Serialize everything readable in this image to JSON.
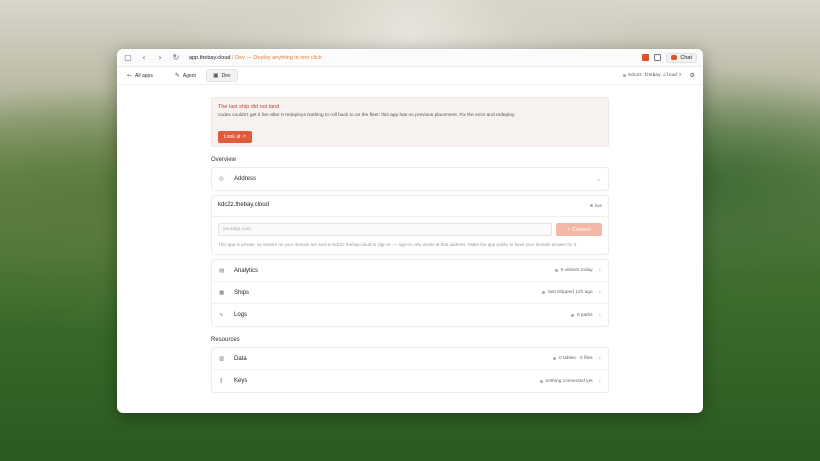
{
  "titlebar": {
    "url_host": "app.thebay.cloud",
    "url_sep": " / ",
    "url_sub": "Dev — Deploy anything in one click",
    "chat_label": "Chat"
  },
  "nav": {
    "all_apps": "All apps",
    "tabs": [
      {
        "label": "Agent"
      },
      {
        "label": "Dev"
      }
    ],
    "domain_chip": "kdc2z.thebay.cloud",
    "domain_close": "×"
  },
  "alert": {
    "title": "The last ship did not land",
    "body": "codex couldn't get it live after 0 redeploys Nothing to roll back to on the fleet: this app has no previous placement. Fix the error and redeploy.",
    "button": "Look at ↗"
  },
  "overview": {
    "heading": "Overview",
    "address_label": "Address",
    "host": "kdc2z.thebay.cloud",
    "live": "live",
    "input_placeholder": "yourapp.com",
    "connect_label": "Connect",
    "hint": "This app is private, so visitors on your domain are sent to kdc2z.thebay.cloud to sign in. — sign-in only works at that address. Make the app public to have your domain answer for it.",
    "rows": [
      {
        "icon": "analytics-icon",
        "label": "Analytics",
        "meta": "0 visitors today"
      },
      {
        "icon": "ships-icon",
        "label": "Ships",
        "meta": "last shipped 12h ago"
      },
      {
        "icon": "logs-icon",
        "label": "Logs",
        "meta": "0 paths"
      }
    ]
  },
  "resources": {
    "heading": "Resources",
    "rows": [
      {
        "icon": "database-icon",
        "label": "Data",
        "meta": "0 tables · 0 files"
      },
      {
        "icon": "key-icon",
        "label": "Keys",
        "meta": "nothing connected yet"
      }
    ]
  },
  "colors": {
    "accent": "#e05a3c",
    "alert_title": "#c0453a",
    "alert_bg": "#f7f2f0"
  }
}
